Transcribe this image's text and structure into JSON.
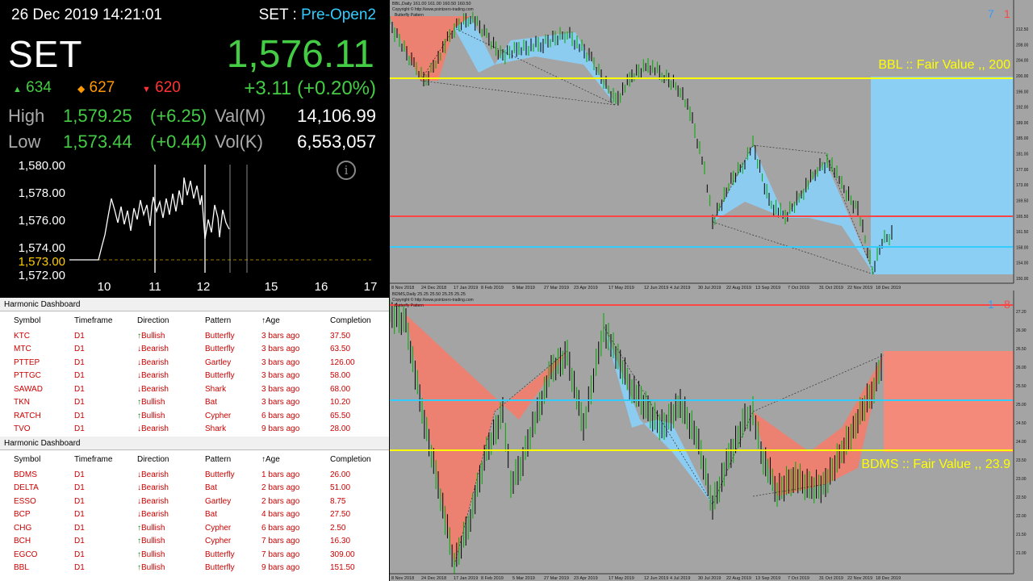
{
  "ticker": {
    "datetime": "26 Dec 2019 14:21:01",
    "market_label": "SET : ",
    "session": "Pre-Open2",
    "index_name": "SET",
    "index_value": "1,576.11",
    "change": "+3.11 (+0.20%)",
    "advances": "634",
    "unchanged": "627",
    "declines": "620",
    "high_label": "High",
    "high_value": "1,579.25",
    "high_change": "(+6.25)",
    "low_label": "Low",
    "low_value": "1,573.44",
    "low_change": "(+0.44)",
    "val_label": "Val(M)",
    "val_value": "14,106.99",
    "vol_label": "Vol(K)",
    "vol_value": "6,553,057",
    "info_icon": "info-icon"
  },
  "intraday_chart": {
    "y_ticks": [
      "1,580.00",
      "1,578.00",
      "1,576.00",
      "1,574.00",
      "1,573.00",
      "1,572.00"
    ],
    "x_ticks": [
      "10",
      "11",
      "12",
      "15",
      "16",
      "17"
    ],
    "previous_close": "1,573.00",
    "colors": {
      "line": "#ffffff",
      "prev": "#ffcc00"
    }
  },
  "dashboards": [
    {
      "title": "Harmonic Dashboard",
      "headers": [
        "Symbol",
        "Timeframe",
        "Direction",
        "Pattern",
        "↑Age",
        "Completion"
      ],
      "rows": [
        {
          "symbol": "KTC",
          "tf": "D1",
          "dir": "Bullish",
          "pattern": "Butterfly",
          "age": "3 bars ago",
          "completion": "37.50"
        },
        {
          "symbol": "MTC",
          "tf": "D1",
          "dir": "Bearish",
          "pattern": "Butterfly",
          "age": "3 bars ago",
          "completion": "63.50"
        },
        {
          "symbol": "PTTEP",
          "tf": "D1",
          "dir": "Bearish",
          "pattern": "Gartley",
          "age": "3 bars ago",
          "completion": "126.00"
        },
        {
          "symbol": "PTTGC",
          "tf": "D1",
          "dir": "Bearish",
          "pattern": "Butterfly",
          "age": "3 bars ago",
          "completion": "58.00"
        },
        {
          "symbol": "SAWAD",
          "tf": "D1",
          "dir": "Bearish",
          "pattern": "Shark",
          "age": "3 bars ago",
          "completion": "68.00"
        },
        {
          "symbol": "TKN",
          "tf": "D1",
          "dir": "Bullish",
          "pattern": "Bat",
          "age": "3 bars ago",
          "completion": "10.20"
        },
        {
          "symbol": "RATCH",
          "tf": "D1",
          "dir": "Bullish",
          "pattern": "Cypher",
          "age": "6 bars ago",
          "completion": "65.50"
        },
        {
          "symbol": "TVO",
          "tf": "D1",
          "dir": "Bearish",
          "pattern": "Shark",
          "age": "9 bars ago",
          "completion": "28.00"
        }
      ]
    },
    {
      "title": "Harmonic Dashboard",
      "headers": [
        "Symbol",
        "Timeframe",
        "Direction",
        "Pattern",
        "↑Age",
        "Completion"
      ],
      "rows": [
        {
          "symbol": "BDMS",
          "tf": "D1",
          "dir": "Bearish",
          "pattern": "Butterfly",
          "age": "1 bars ago",
          "completion": "26.00"
        },
        {
          "symbol": "DELTA",
          "tf": "D1",
          "dir": "Bearish",
          "pattern": "Bat",
          "age": "2 bars ago",
          "completion": "51.00"
        },
        {
          "symbol": "ESSO",
          "tf": "D1",
          "dir": "Bearish",
          "pattern": "Gartley",
          "age": "2 bars ago",
          "completion": "8.75"
        },
        {
          "symbol": "BCP",
          "tf": "D1",
          "dir": "Bearish",
          "pattern": "Bat",
          "age": "4 bars ago",
          "completion": "27.50"
        },
        {
          "symbol": "CHG",
          "tf": "D1",
          "dir": "Bullish",
          "pattern": "Cypher",
          "age": "6 bars ago",
          "completion": "2.50"
        },
        {
          "symbol": "BCH",
          "tf": "D1",
          "dir": "Bullish",
          "pattern": "Cypher",
          "age": "7 bars ago",
          "completion": "16.30"
        },
        {
          "symbol": "EGCO",
          "tf": "D1",
          "dir": "Bullish",
          "pattern": "Butterfly",
          "age": "7 bars ago",
          "completion": "309.00"
        },
        {
          "symbol": "BBL",
          "tf": "D1",
          "dir": "Bullish",
          "pattern": "Butterfly",
          "age": "9 bars ago",
          "completion": "151.50"
        }
      ]
    }
  ],
  "charts": [
    {
      "symbol_line": "BBL,Daily 161.00 161.00 160.50 160.50",
      "copyright": "Copyright © http://www.pointzero-trading.com",
      "pattern_label": "Butterfly Pattern",
      "fair_value_label": "BBL :: Fair Value ,, 200",
      "count_a": "7",
      "count_b": "1",
      "y_ticks": [
        "212.50",
        "208.00",
        "204.00",
        "200.00",
        "196.00",
        "192.00",
        "189.00",
        "185.00",
        "181.00",
        "177.00",
        "173.00",
        "169.50",
        "165.50",
        "161.50",
        "158.00",
        "154.00",
        "150.00"
      ],
      "x_ticks": [
        "8 Nov 2018",
        "24 Dec 2018",
        "17 Jan 2019",
        "8 Feb 2019",
        "5 Mar 2019",
        "27 Mar 2019",
        "23 Apr 2019",
        "17 May 2019",
        "12 Jun 2019",
        "4 Jul 2019",
        "30 Jul 2019",
        "22 Aug 2019",
        "13 Sep 2019",
        "7 Oct 2019",
        "31 Oct 2019",
        "22 Nov 2019",
        "18 Dec 2019"
      ]
    },
    {
      "symbol_line": "BDMS,Daily 25.25 25.50 25.25 25.25",
      "copyright": "Copyright © http://www.pointzero-trading.com",
      "pattern_label": "Butterfly Pattern",
      "fair_value_label": "BDMS :: Fair Value ,, 23.9",
      "count_a": "1",
      "count_b": "8",
      "y_ticks": [
        "27.20",
        "26.90",
        "26.50",
        "26.00",
        "25.50",
        "25.00",
        "24.50",
        "24.00",
        "23.50",
        "23.00",
        "22.50",
        "22.00",
        "21.50",
        "21.00"
      ],
      "x_ticks": [
        "8 Nov 2018",
        "24 Dec 2018",
        "17 Jan 2019",
        "8 Feb 2019",
        "5 Mar 2019",
        "27 Mar 2019",
        "23 Apr 2019",
        "17 May 2019",
        "12 Jun 2019",
        "4 Jul 2019",
        "30 Jul 2019",
        "22 Aug 2019",
        "13 Sep 2019",
        "7 Oct 2019",
        "31 Oct 2019",
        "22 Nov 2019",
        "18 Dec 2019"
      ]
    }
  ]
}
